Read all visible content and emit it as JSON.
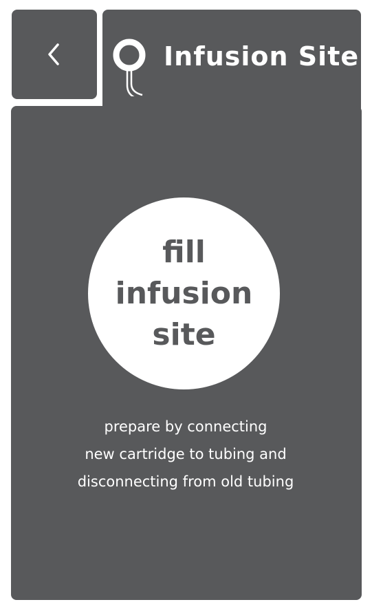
{
  "header": {
    "title": "Infusion Site",
    "back_icon": "chevron-left-icon",
    "site_icon": "infusion-site-icon"
  },
  "main": {
    "action_label_lines": [
      "fill",
      "infusion",
      "site"
    ],
    "instructions": [
      "prepare by connecting",
      "new cartridge to tubing and",
      "disconnecting from old tubing"
    ]
  },
  "colors": {
    "panel": "#58595b",
    "foreground": "#ffffff",
    "background": "#ffffff"
  }
}
